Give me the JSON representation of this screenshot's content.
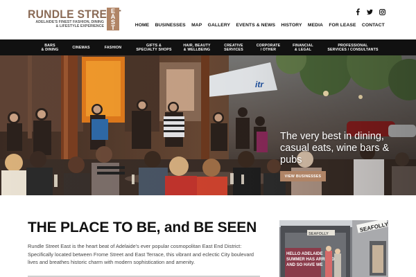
{
  "brand": {
    "name": "RUNDLE STREET",
    "east": [
      "E",
      "A",
      "S",
      "T"
    ],
    "tagline_1": "ADELAIDE'S FINEST FASHION, DINING",
    "tagline_2": "& LIFESTYLE EXPERIENCE",
    "accent_color": "#b08466"
  },
  "social": [
    {
      "name": "facebook-icon",
      "glyph": "f"
    },
    {
      "name": "twitter-icon",
      "glyph": "t"
    },
    {
      "name": "instagram-icon",
      "glyph": "i"
    }
  ],
  "topnav": [
    {
      "label": "HOME"
    },
    {
      "label": "BUSINESSES"
    },
    {
      "label": "MAP"
    },
    {
      "label": "GALLERY"
    },
    {
      "label": "EVENTS & NEWS"
    },
    {
      "label": "HISTORY"
    },
    {
      "label": "MEDIA"
    },
    {
      "label": "FOR LEASE"
    },
    {
      "label": "CONTACT"
    }
  ],
  "categories": [
    {
      "line1": "BARS",
      "line2": "& DINING"
    },
    {
      "line1": "CINEMAS",
      "line2": ""
    },
    {
      "line1": "FASHION",
      "line2": ""
    },
    {
      "line1": "GIFTS &",
      "line2": "SPECIALTY SHOPS"
    },
    {
      "line1": "HAIR, BEAUTY",
      "line2": "& WELLBEING"
    },
    {
      "line1": "CREATIVE",
      "line2": "SERVICES"
    },
    {
      "line1": "CORPORATE",
      "line2": "/ OTHER"
    },
    {
      "line1": "FINANCIAL",
      "line2": "& LEGAL"
    },
    {
      "line1": "PROFESSIONAL",
      "line2": "SERVICES / CONSULTANTS"
    }
  ],
  "hero": {
    "heading": "The very best in dining, casual eats, wine bars & pubs",
    "button": "VIEW BUSINESSES",
    "awning_text": "itr"
  },
  "content": {
    "title": "THE PLACE TO BE, and BE SEEN",
    "intro": "Rundle Street East is the heart beat of Adelaide's ever popular cosmopolitan East End District: Specifically located between Frome Street and East Terrace, this vibrant and eclectic City boulevard lives and breathes historic charm with modern sophistication and amenity."
  },
  "promo": {
    "sign": "SEAFOLLY",
    "sign2": "SEAFOLLY",
    "poster_1": "HELLO ADELAIDE",
    "poster_2": "SUMMER HAS ARRIVED",
    "poster_3": "AND SO HAVE WE"
  }
}
